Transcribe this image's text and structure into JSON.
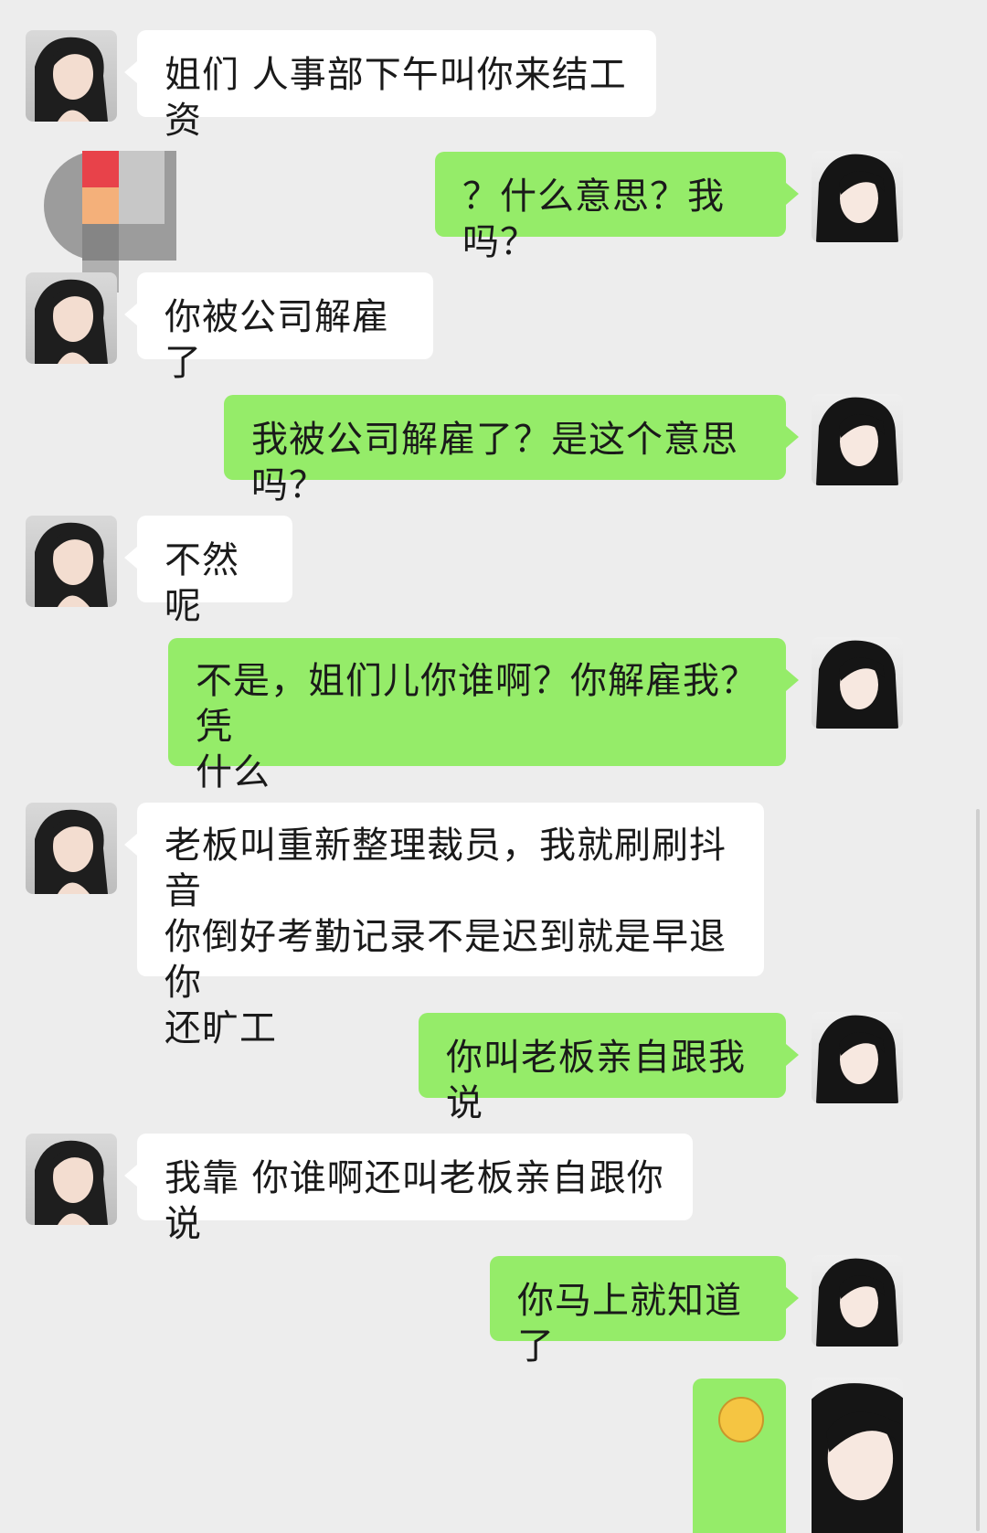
{
  "messages": [
    {
      "side": "left",
      "text": "姐们 人事部下午叫你来结工资"
    },
    {
      "side": "right",
      "text": "？什么意思？我吗？"
    },
    {
      "side": "left",
      "text": "你被公司解雇了"
    },
    {
      "side": "right",
      "text": "我被公司解雇了？是这个意思吗？"
    },
    {
      "side": "left",
      "text": "不然呢"
    },
    {
      "side": "right",
      "line1": "不是，姐们儿你谁啊？你解雇我？凭",
      "line2": "什么"
    },
    {
      "side": "left",
      "line1": "老板叫重新整理裁员，我就刷刷抖音",
      "line2": "你倒好考勤记录不是迟到就是早退你",
      "line3": "还旷工"
    },
    {
      "side": "right",
      "text": "你叫老板亲自跟我说"
    },
    {
      "side": "left",
      "text": "我靠 你谁啊还叫老板亲自跟你说"
    },
    {
      "side": "right",
      "text": "你马上就知道了"
    }
  ],
  "colors": {
    "background": "#ededed",
    "left_bubble": "#ffffff",
    "right_bubble": "#95ec69"
  },
  "icons": {
    "left_avatar": "avatar-portrait-icon",
    "right_avatar": "avatar-portrait-icon",
    "emoji": "smiley-emoji-icon"
  }
}
